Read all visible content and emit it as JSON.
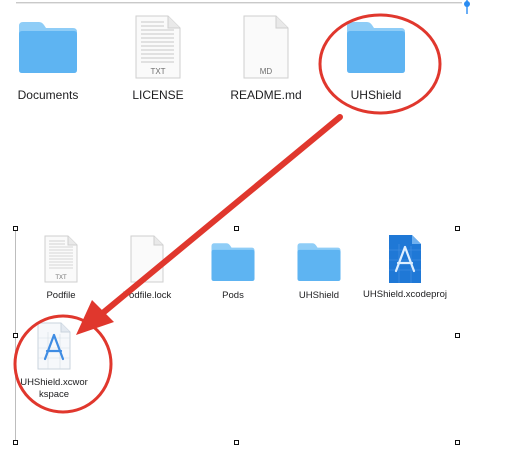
{
  "top_row": [
    {
      "name": "Documents",
      "kind": "folder"
    },
    {
      "name": "LICENSE",
      "kind": "document",
      "badge": "TXT"
    },
    {
      "name": "README.md",
      "kind": "document",
      "badge": "MD"
    },
    {
      "name": "UHShield",
      "kind": "folder"
    }
  ],
  "bottom_row": [
    {
      "name": "Podfile",
      "kind": "document",
      "badge": "TXT"
    },
    {
      "name": "Podfile.lock",
      "kind": "document"
    },
    {
      "name": "Pods",
      "kind": "folder"
    },
    {
      "name": "UHShield",
      "kind": "folder"
    },
    {
      "name": "UHShield.xcodeproj",
      "kind": "xcodeproj"
    }
  ],
  "workspace": {
    "name": "UHShield.xcworkspace",
    "kind": "xcworkspace"
  },
  "colors": {
    "annotation": "#e0372d",
    "folder_body": "#5eb4f2",
    "folder_tab": "#8fcdf7",
    "pin": "#2a8cf2"
  }
}
